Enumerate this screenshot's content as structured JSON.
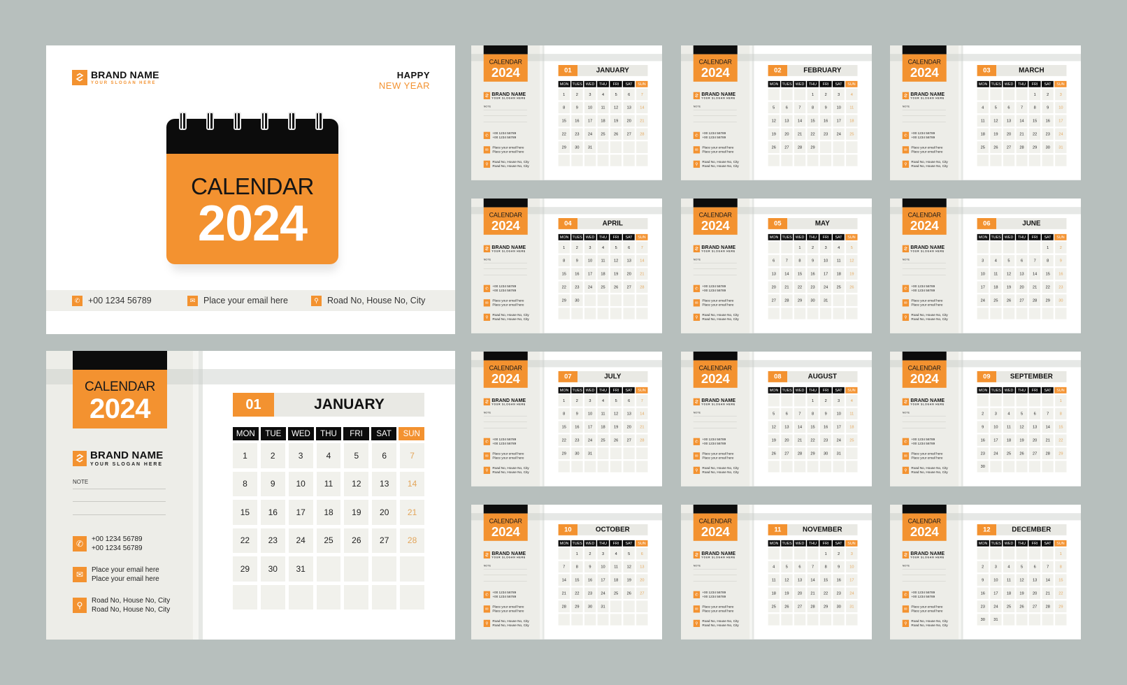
{
  "brand": {
    "name": "BRAND NAME",
    "slogan": "YOUR SLOGAN HERE"
  },
  "colors": {
    "accent": "#f39230",
    "dark": "#0c0c0c",
    "panel": "#edede8",
    "background": "#b7bfbd"
  },
  "cover": {
    "greeting_line1": "HAPPY",
    "greeting_line2": "NEW YEAR",
    "calendar_word": "CALENDAR",
    "year": "2024",
    "contact": {
      "phone": "+00 1234 56789",
      "email": "Place your email here",
      "address": "Road No, House No, City"
    },
    "icons": [
      "phone-icon",
      "email-icon",
      "location-pin-icon"
    ]
  },
  "page_common": {
    "calendar_word": "CALENDAR",
    "year": "2024",
    "note_label": "NOTE",
    "phone_lines": [
      "+00 1234 56789",
      "+00 1234 56789"
    ],
    "email_lines": [
      "Place your email here",
      "Place your email here"
    ],
    "address_lines": [
      "Road No, House No, City",
      "Road No, House No, City"
    ]
  },
  "large_page": {
    "weekday_labels": [
      "MON",
      "TUE",
      "WED",
      "THU",
      "FRI",
      "SAT",
      "SUN"
    ]
  },
  "thumb_weekday_labels": [
    "MON",
    "TUES",
    "WED",
    "THU",
    "FRI",
    "SAT",
    "SUN"
  ],
  "months": [
    {
      "num": "01",
      "name": "JANUARY",
      "days": [
        "1",
        "2",
        "3",
        "4",
        "5",
        "6",
        "7",
        "8",
        "9",
        "10",
        "11",
        "12",
        "13",
        "14",
        "15",
        "16",
        "17",
        "18",
        "19",
        "20",
        "21",
        "22",
        "23",
        "24",
        "25",
        "26",
        "27",
        "28",
        "29",
        "30",
        "31",
        "",
        "",
        "",
        "",
        "",
        "",
        "",
        "",
        "",
        "",
        ""
      ]
    },
    {
      "num": "02",
      "name": "FEBRUARY",
      "days": [
        "",
        "",
        "",
        "1",
        "2",
        "3",
        "4",
        "5",
        "6",
        "7",
        "8",
        "9",
        "10",
        "11",
        "12",
        "13",
        "14",
        "15",
        "16",
        "17",
        "18",
        "19",
        "20",
        "21",
        "22",
        "23",
        "24",
        "25",
        "26",
        "27",
        "28",
        "29",
        "",
        "",
        "",
        "",
        "",
        "",
        "",
        "",
        "",
        ""
      ]
    },
    {
      "num": "03",
      "name": "MARCH",
      "days": [
        "",
        "",
        "",
        "",
        "1",
        "2",
        "3",
        "4",
        "5",
        "6",
        "7",
        "8",
        "9",
        "10",
        "11",
        "12",
        "13",
        "14",
        "15",
        "16",
        "17",
        "18",
        "19",
        "20",
        "21",
        "22",
        "23",
        "24",
        "25",
        "26",
        "27",
        "28",
        "29",
        "30",
        "31",
        "",
        "",
        "",
        "",
        "",
        "",
        ""
      ]
    },
    {
      "num": "04",
      "name": "APRIL",
      "days": [
        "1",
        "2",
        "3",
        "4",
        "5",
        "6",
        "7",
        "8",
        "9",
        "10",
        "11",
        "12",
        "13",
        "14",
        "15",
        "16",
        "17",
        "18",
        "19",
        "20",
        "21",
        "22",
        "23",
        "24",
        "25",
        "26",
        "27",
        "28",
        "29",
        "30",
        "",
        "",
        "",
        "",
        "",
        "",
        "",
        "",
        "",
        "",
        "",
        ""
      ]
    },
    {
      "num": "05",
      "name": "MAY",
      "days": [
        "",
        "",
        "1",
        "2",
        "3",
        "4",
        "5",
        "6",
        "7",
        "8",
        "9",
        "10",
        "11",
        "12",
        "13",
        "14",
        "15",
        "16",
        "17",
        "18",
        "19",
        "20",
        "21",
        "22",
        "23",
        "24",
        "25",
        "26",
        "27",
        "28",
        "29",
        "30",
        "31",
        "",
        "",
        "",
        "",
        "",
        "",
        "",
        "",
        ""
      ]
    },
    {
      "num": "06",
      "name": "JUNE",
      "days": [
        "",
        "",
        "",
        "",
        "",
        "1",
        "2",
        "3",
        "4",
        "5",
        "6",
        "7",
        "8",
        "9",
        "10",
        "11",
        "12",
        "13",
        "14",
        "15",
        "16",
        "17",
        "18",
        "19",
        "20",
        "21",
        "22",
        "23",
        "24",
        "25",
        "26",
        "27",
        "28",
        "29",
        "30",
        "",
        "",
        "",
        "",
        "",
        "",
        ""
      ]
    },
    {
      "num": "07",
      "name": "JULY",
      "days": [
        "1",
        "2",
        "3",
        "4",
        "5",
        "6",
        "7",
        "8",
        "9",
        "10",
        "11",
        "12",
        "13",
        "14",
        "15",
        "16",
        "17",
        "18",
        "19",
        "20",
        "21",
        "22",
        "23",
        "24",
        "25",
        "26",
        "27",
        "28",
        "29",
        "30",
        "31",
        "",
        "",
        "",
        "",
        "",
        "",
        "",
        "",
        "",
        "",
        ""
      ]
    },
    {
      "num": "08",
      "name": "AUGUST",
      "days": [
        "",
        "",
        "",
        "1",
        "2",
        "3",
        "4",
        "5",
        "6",
        "7",
        "8",
        "9",
        "10",
        "11",
        "12",
        "13",
        "14",
        "15",
        "16",
        "17",
        "18",
        "19",
        "20",
        "21",
        "22",
        "23",
        "24",
        "25",
        "26",
        "27",
        "28",
        "29",
        "30",
        "31",
        "",
        "",
        "",
        "",
        "",
        "",
        "",
        ""
      ]
    },
    {
      "num": "09",
      "name": "SEPTEMBER",
      "days": [
        "",
        "",
        "",
        "",
        "",
        "",
        "1",
        "2",
        "3",
        "4",
        "5",
        "6",
        "7",
        "8",
        "9",
        "10",
        "11",
        "12",
        "13",
        "14",
        "15",
        "16",
        "17",
        "18",
        "19",
        "20",
        "21",
        "22",
        "23",
        "24",
        "25",
        "26",
        "27",
        "28",
        "29",
        "30",
        "",
        "",
        "",
        "",
        "",
        ""
      ]
    },
    {
      "num": "10",
      "name": "OCTOBER",
      "days": [
        "",
        "1",
        "2",
        "3",
        "4",
        "5",
        "6",
        "7",
        "8",
        "9",
        "10",
        "11",
        "12",
        "13",
        "14",
        "15",
        "16",
        "17",
        "18",
        "19",
        "20",
        "21",
        "22",
        "23",
        "24",
        "25",
        "26",
        "27",
        "28",
        "29",
        "30",
        "31",
        "",
        "",
        "",
        "",
        "",
        "",
        "",
        "",
        "",
        ""
      ]
    },
    {
      "num": "11",
      "name": "NOVEMBER",
      "days": [
        "",
        "",
        "",
        "",
        "1",
        "2",
        "3",
        "4",
        "5",
        "6",
        "7",
        "8",
        "9",
        "10",
        "11",
        "12",
        "13",
        "14",
        "15",
        "16",
        "17",
        "18",
        "19",
        "20",
        "21",
        "22",
        "23",
        "24",
        "25",
        "26",
        "27",
        "28",
        "29",
        "30",
        "31",
        "",
        "",
        "",
        "",
        "",
        "",
        ""
      ]
    },
    {
      "num": "12",
      "name": "DECEMBER",
      "days": [
        "",
        "",
        "",
        "",
        "",
        "",
        "1",
        "2",
        "3",
        "4",
        "5",
        "6",
        "7",
        "8",
        "9",
        "10",
        "11",
        "12",
        "13",
        "14",
        "15",
        "16",
        "17",
        "18",
        "19",
        "20",
        "21",
        "22",
        "23",
        "24",
        "25",
        "26",
        "27",
        "28",
        "29",
        "30",
        "31",
        "",
        "",
        "",
        "",
        ""
      ]
    }
  ]
}
